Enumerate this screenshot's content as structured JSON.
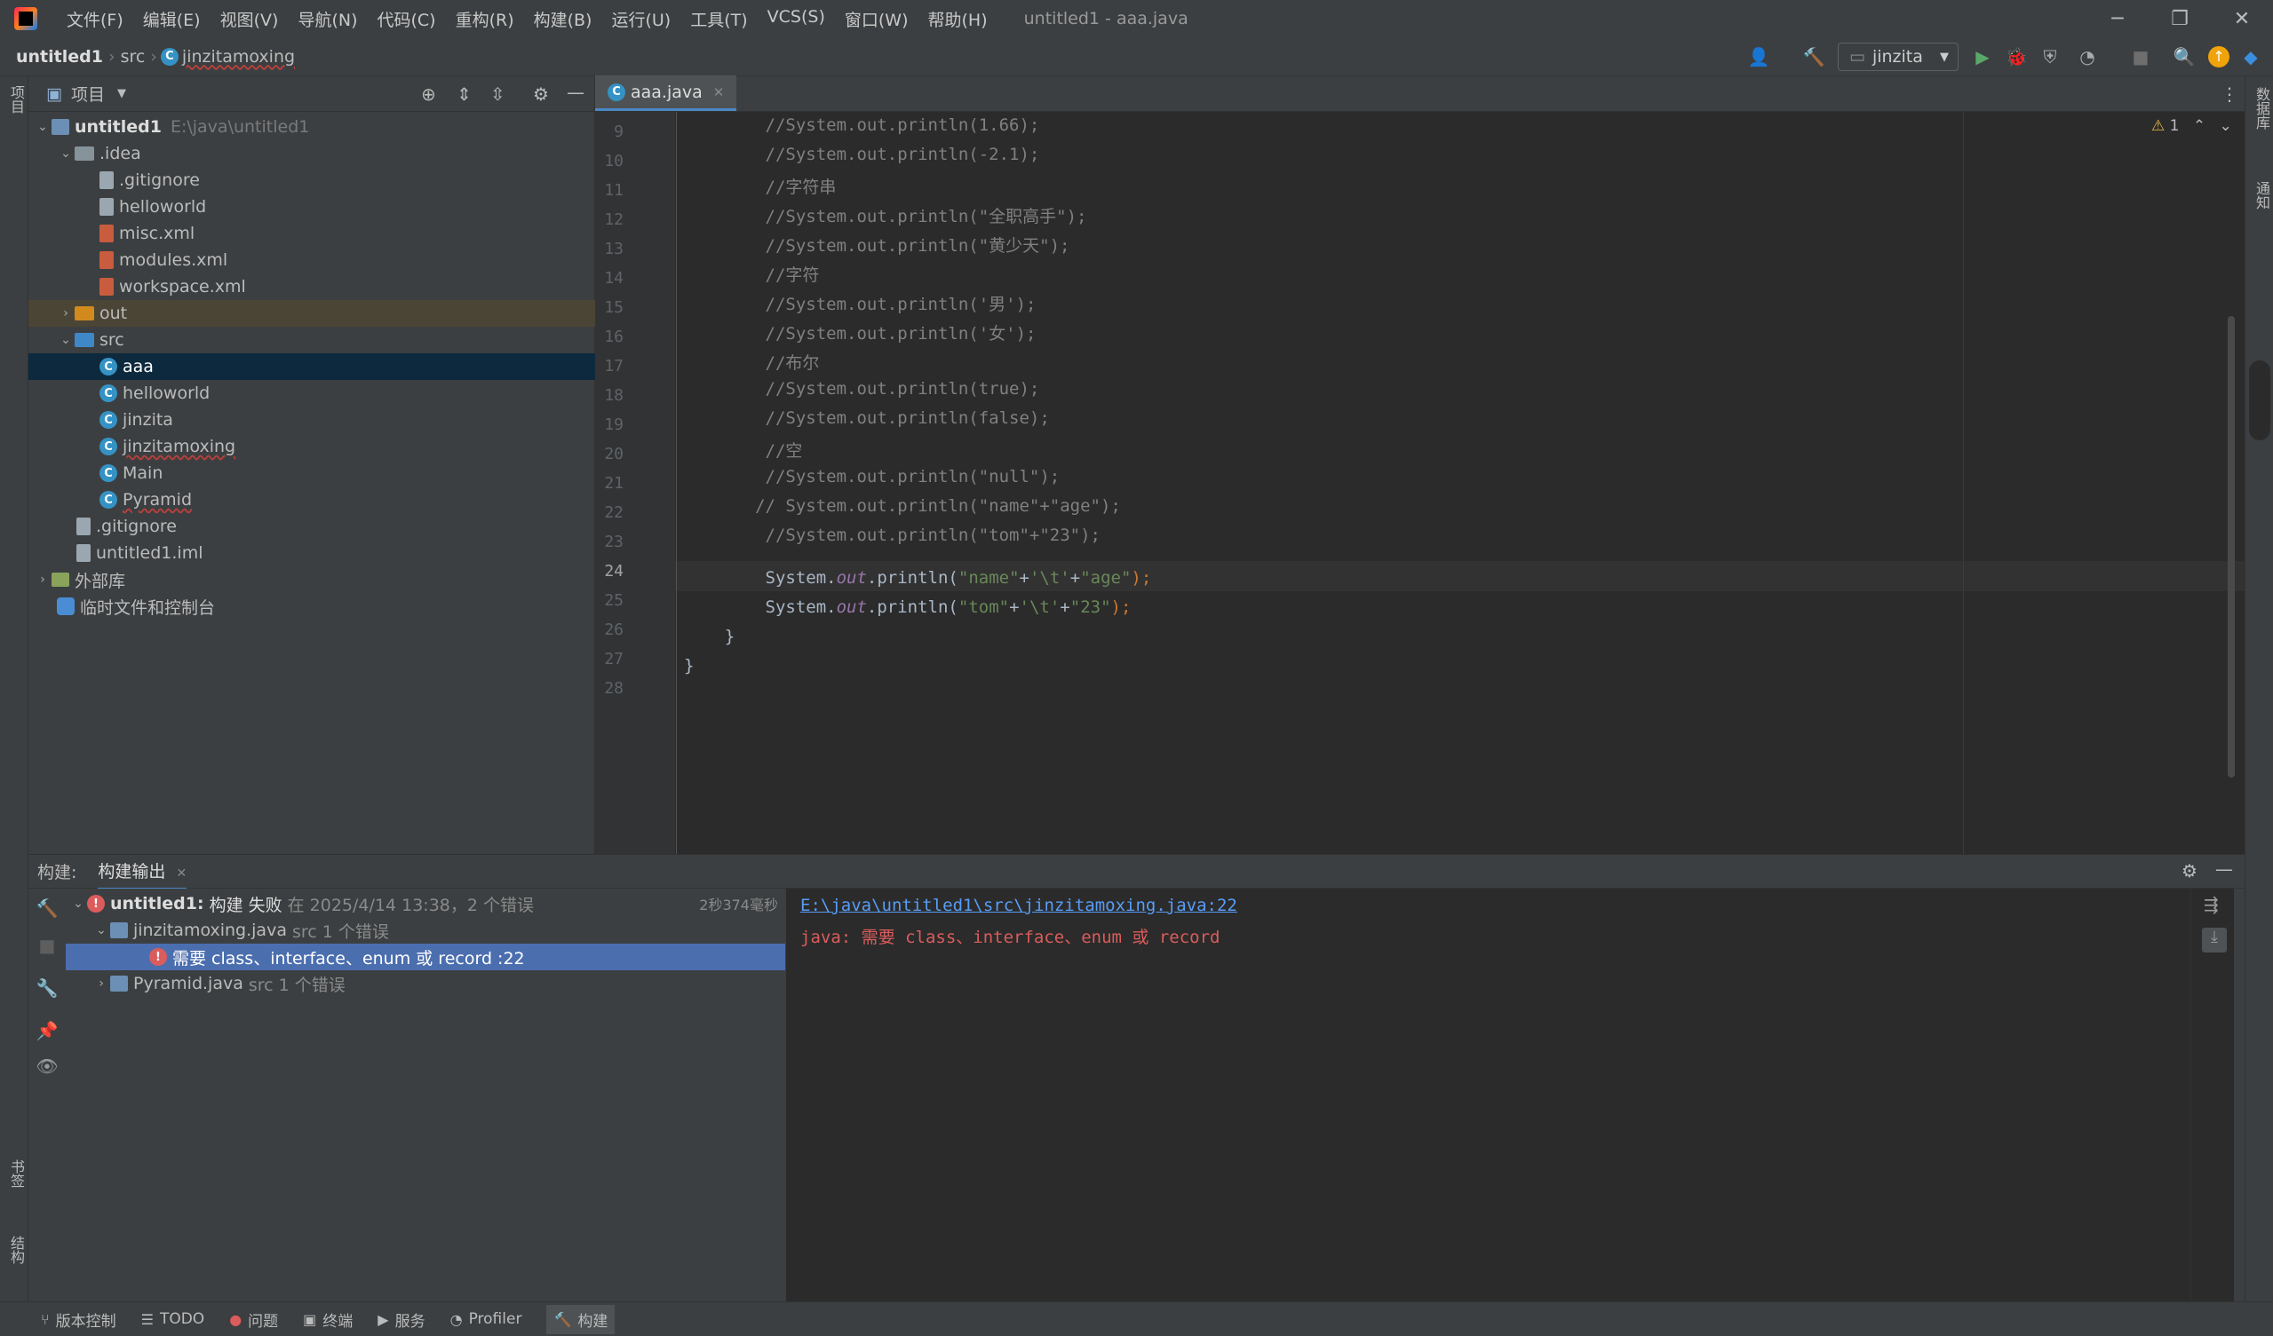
{
  "menu": [
    "文件(F)",
    "编辑(E)",
    "视图(V)",
    "导航(N)",
    "代码(C)",
    "重构(R)",
    "构建(B)",
    "运行(U)",
    "工具(T)",
    "VCS(S)",
    "窗口(W)",
    "帮助(H)"
  ],
  "window_title": "untitled1 - aaa.java",
  "breadcrumb": {
    "project": "untitled1",
    "folder": "src",
    "file": "jinzitamoxing"
  },
  "run_config": "jinzita",
  "left_strip": {
    "project_label": "项目",
    "bookmarks_label": "书签",
    "structure_label": "结构"
  },
  "right_strip": {
    "database_label": "数据库",
    "notifications_label": "通知"
  },
  "project_panel": {
    "title": "项目",
    "tree": [
      {
        "label": "untitled1",
        "path": "E:\\java\\untitled1",
        "icon": "module"
      },
      {
        "label": ".idea",
        "icon": "folder"
      },
      {
        "label": ".gitignore",
        "icon": "file"
      },
      {
        "label": "helloworld",
        "icon": "file"
      },
      {
        "label": "misc.xml",
        "icon": "xml"
      },
      {
        "label": "modules.xml",
        "icon": "xml"
      },
      {
        "label": "workspace.xml",
        "icon": "xml"
      },
      {
        "label": "out",
        "icon": "folder-out"
      },
      {
        "label": "src",
        "icon": "folder-src"
      },
      {
        "label": "aaa",
        "icon": "class"
      },
      {
        "label": "helloworld",
        "icon": "class"
      },
      {
        "label": "jinzita",
        "icon": "class"
      },
      {
        "label": "jinzitamoxing",
        "icon": "class"
      },
      {
        "label": "Main",
        "icon": "class"
      },
      {
        "label": "Pyramid",
        "icon": "class"
      },
      {
        "label": ".gitignore",
        "icon": "file"
      },
      {
        "label": "untitled1.iml",
        "icon": "file"
      },
      {
        "label": "外部库",
        "icon": "lib"
      },
      {
        "label": "临时文件和控制台",
        "icon": "scratch"
      }
    ]
  },
  "editor": {
    "tab": "aaa.java",
    "warnings": "1",
    "line_numbers": [
      "9",
      "10",
      "11",
      "12",
      "13",
      "14",
      "15",
      "16",
      "17",
      "18",
      "19",
      "20",
      "21",
      "22",
      "23",
      "24",
      "25",
      "26",
      "27",
      "28"
    ],
    "lines": [
      {
        "comment": "        //System.out.println(1.66);"
      },
      {
        "comment": "        //System.out.println(-2.1);"
      },
      {
        "comment": "        //字符串"
      },
      {
        "comment": "        //System.out.println(\"全职高手\");"
      },
      {
        "comment": "        //System.out.println(\"黄少天\");"
      },
      {
        "comment": "        //字符"
      },
      {
        "comment": "        //System.out.println('男');"
      },
      {
        "comment": "        //System.out.println('女');"
      },
      {
        "comment": "        //布尔"
      },
      {
        "comment": "        //System.out.println(true);"
      },
      {
        "comment": "        //System.out.println(false);"
      },
      {
        "comment": "        //空"
      },
      {
        "comment": "        //System.out.println(\"null\");"
      },
      {
        "comment": "       // System.out.println(\"name\"+\"age\");"
      },
      {
        "comment": "        //System.out.println(\"tom\"+\"23\");"
      }
    ],
    "code24": {
      "pre": "        System.",
      "out": "out",
      "mid": ".println(",
      "s1": "\"name\"",
      "p1": "+",
      "c1": "'\\t'",
      "p2": "+",
      "s2": "\"age\"",
      "end": ");"
    },
    "code25": {
      "pre": "        System.",
      "out": "out",
      "mid": ".println(",
      "s1": "\"tom\"",
      "p1": "+",
      "c1": "'\\t'",
      "p2": "+",
      "s2": "\"23\"",
      "end": ");"
    },
    "code26": "    }",
    "code27": "}"
  },
  "build": {
    "label": "构建:",
    "tab": "构建输出",
    "root_title": "untitled1:",
    "root_status": "构建 失败",
    "root_time": "在 2025/4/14 13:38，2 个错误",
    "duration": "2秒374毫秒",
    "file1": {
      "name": "jinzitamoxing.java",
      "meta": "src 1 个错误"
    },
    "error1": "需要 class、interface、enum 或 record :22",
    "file2": {
      "name": "Pyramid.java",
      "meta": "src 1 个错误"
    },
    "console_link": "E:\\java\\untitled1\\src\\jinzitamoxing.java:22",
    "console_error": "java: 需要 class、interface、enum 或 record"
  },
  "statusbar": [
    "版本控制",
    "TODO",
    "问题",
    "终端",
    "服务",
    "Profiler",
    "构建"
  ],
  "colors": {
    "accent": "#4a88c7",
    "error": "#db5c5c",
    "selection": "#0d293e",
    "build_selection": "#4b6eaf",
    "link": "#589df6"
  }
}
